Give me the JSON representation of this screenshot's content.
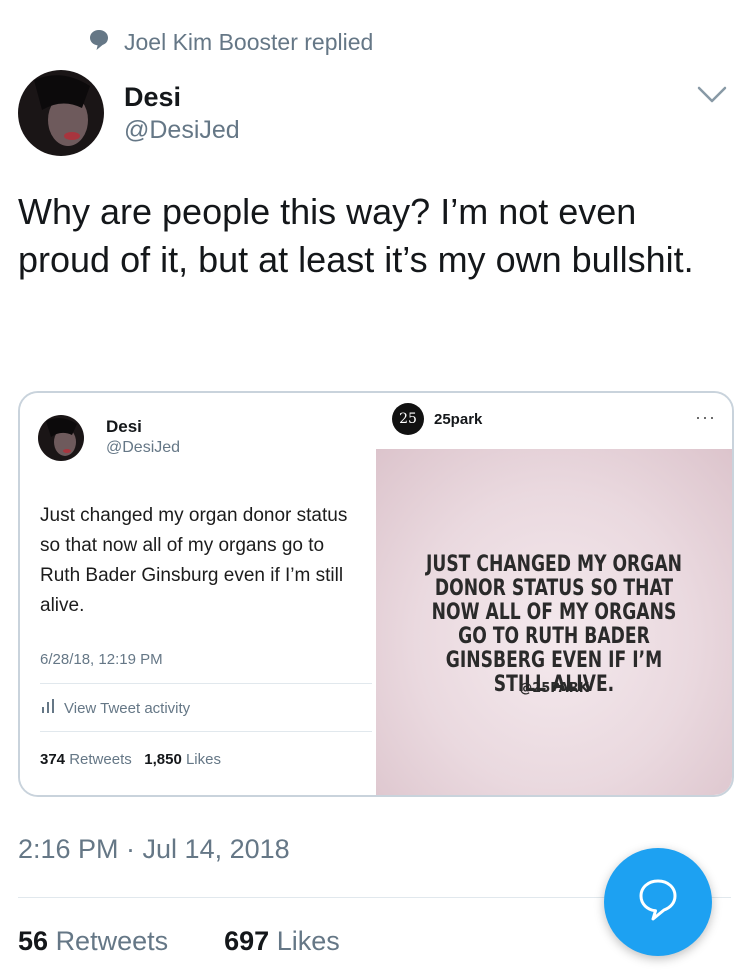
{
  "context": {
    "icon": "speech-bubble-icon",
    "text": "Joel Kim Booster replied"
  },
  "tweet": {
    "name": "Desi",
    "handle": "@DesiJed",
    "text": "Why are people this way? I’m not even proud of it, but at least it’s my own bullshit.",
    "timestamp": "2:16 PM · Jul 14, 2018",
    "retweets_count": "56",
    "retweets_label": "Retweets",
    "likes_count": "697",
    "likes_label": "Likes"
  },
  "embedded": {
    "name": "Desi",
    "handle": "@DesiJed",
    "text": "Just changed my organ donor status  so that now all of my organs go to Ruth Bader Ginsburg even if I’m still alive.",
    "date": "6/28/18, 12:19 PM",
    "activity_label": "View Tweet activity",
    "retweets_count": "374",
    "retweets_label": "Retweets",
    "likes_count": "1,850",
    "likes_label": "Likes"
  },
  "instagram": {
    "logo_text": "25",
    "username": "25park",
    "more": "···",
    "quote": "JUST CHANGED MY ORGAN DONOR STATUS SO THAT NOW ALL OF MY ORGANS GO TO RUTH BADER GINSBERG EVEN IF I’M STILL ALIVE.",
    "quote_handle": "@25PARK"
  },
  "colors": {
    "accent": "#1da1f2",
    "secondary_text": "#657786"
  }
}
